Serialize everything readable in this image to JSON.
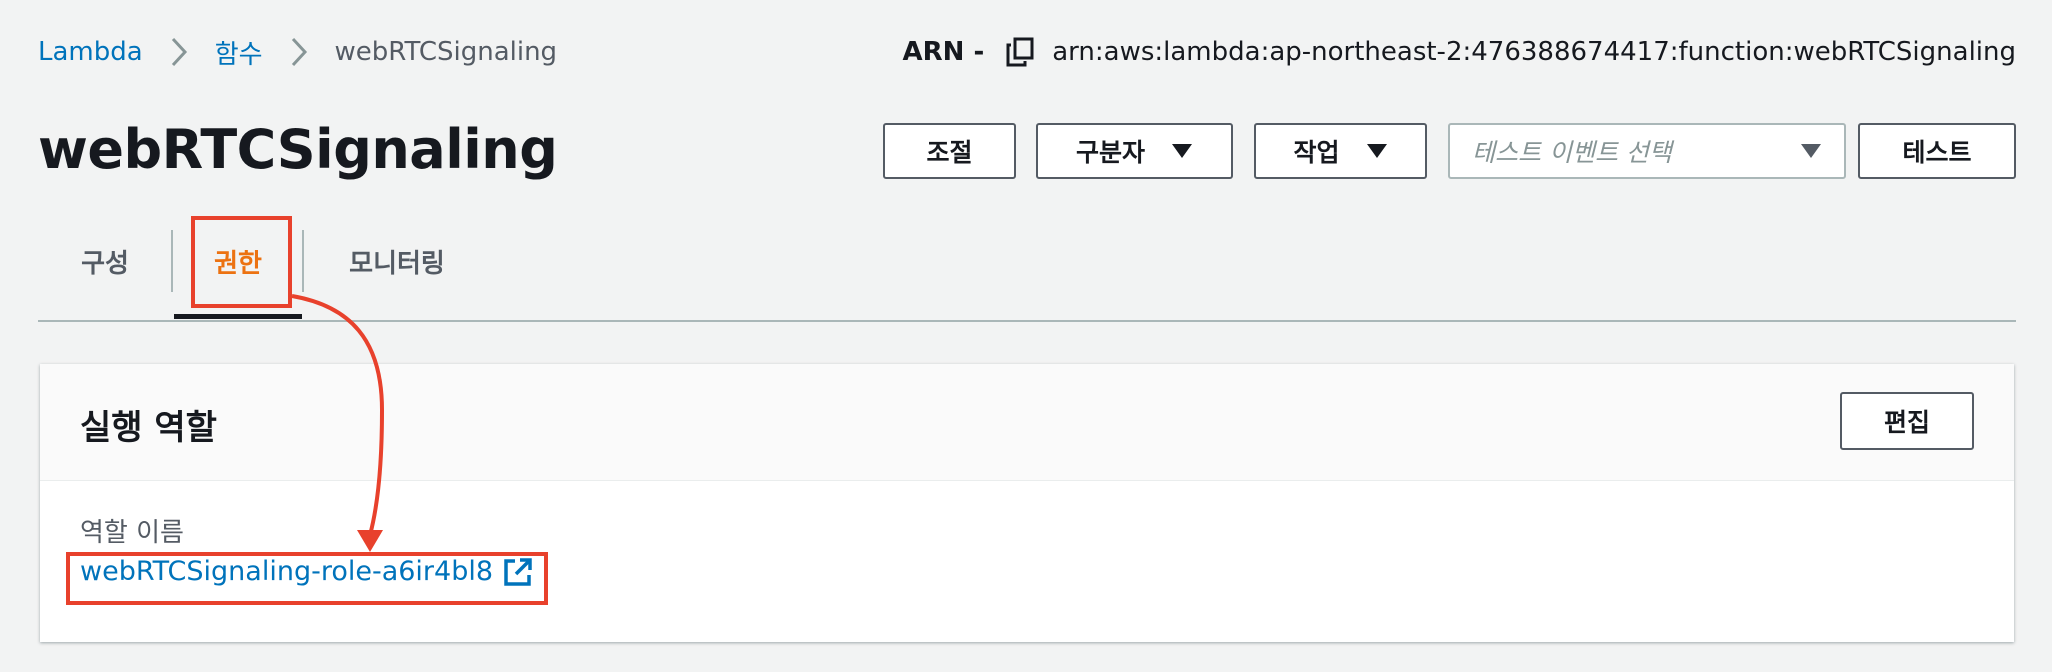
{
  "breadcrumb": {
    "items": [
      "Lambda",
      "함수"
    ],
    "current": "webRTCSignaling"
  },
  "arn": {
    "label": "ARN -",
    "value": "arn:aws:lambda:ap-northeast-2:476388674417:function:webRTCSignaling",
    "copy_icon": "copy-icon"
  },
  "page": {
    "title": "webRTCSignaling"
  },
  "toolbar": {
    "throttle_label": "조절",
    "qualifier_label": "구분자",
    "actions_label": "작업",
    "test_event_placeholder": "테스트 이벤트 선택",
    "test_label": "테스트"
  },
  "tabs": [
    {
      "label": "구성",
      "active": false
    },
    {
      "label": "권한",
      "active": true
    },
    {
      "label": "모니터링",
      "active": false
    }
  ],
  "execution_role": {
    "title": "실행 역할",
    "edit_label": "편집",
    "field_label": "역할 이름",
    "role_name": "webRTCSignaling-role-a6ir4bl8"
  },
  "colors": {
    "link": "#0073bb",
    "active_tab": "#ec7211",
    "annotation": "#e8412c",
    "background": "#f2f3f3"
  }
}
